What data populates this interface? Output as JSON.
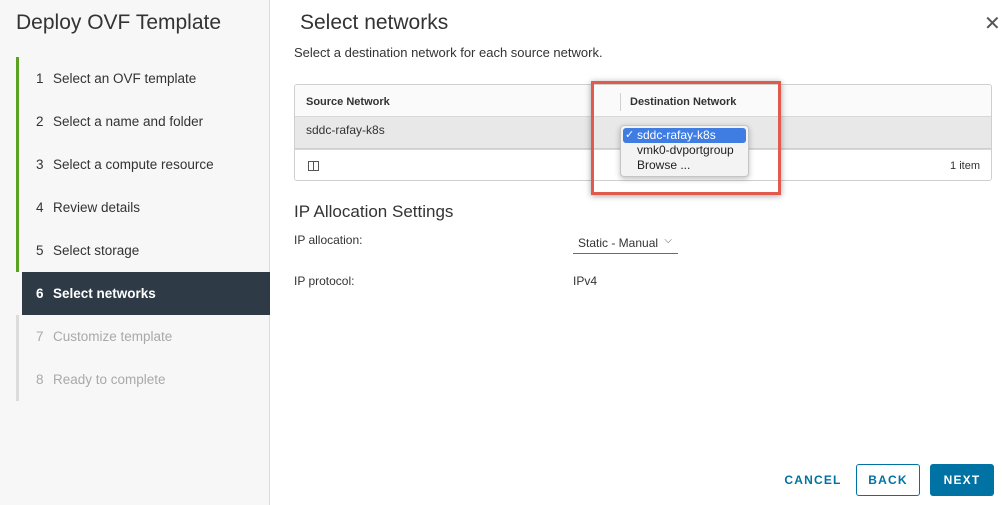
{
  "wizard": {
    "title": "Deploy OVF Template",
    "steps": [
      {
        "num": "1",
        "label": "Select an OVF template",
        "state": "done"
      },
      {
        "num": "2",
        "label": "Select a name and folder",
        "state": "done"
      },
      {
        "num": "3",
        "label": "Select a compute resource",
        "state": "done"
      },
      {
        "num": "4",
        "label": "Review details",
        "state": "done"
      },
      {
        "num": "5",
        "label": "Select storage",
        "state": "done"
      },
      {
        "num": "6",
        "label": "Select networks",
        "state": "active"
      },
      {
        "num": "7",
        "label": "Customize template",
        "state": "todo"
      },
      {
        "num": "8",
        "label": "Ready to complete",
        "state": "todo"
      }
    ]
  },
  "page": {
    "title": "Select networks",
    "subtitle": "Select a destination network for each source network.",
    "close_icon": "close-icon"
  },
  "network_grid": {
    "columns": [
      "Source Network",
      "Destination Network"
    ],
    "rows": [
      {
        "source": "sddc-rafay-k8s",
        "destination": "sddc-rafay-k8s"
      }
    ],
    "footer_count": "1 item",
    "column_toggle_icon": "column-toggle-icon"
  },
  "dropdown": {
    "check": "✓",
    "options": [
      "sddc-rafay-k8s",
      "vmk0-dvportgroup",
      "Browse ..."
    ],
    "selected_index": 0,
    "highlight_color": "#3f7de3"
  },
  "ip_settings": {
    "title": "IP Allocation Settings",
    "allocation_label": "IP allocation:",
    "allocation_value": "Static - Manual",
    "protocol_label": "IP protocol:",
    "protocol_value": "IPv4"
  },
  "footer": {
    "cancel": "CANCEL",
    "back": "BACK",
    "next": "NEXT"
  },
  "colors": {
    "accent": "#0072a3",
    "active_step_bg": "#2e3b46",
    "done_bar": "#5aa220",
    "annotation_box": "#e05a4e"
  }
}
